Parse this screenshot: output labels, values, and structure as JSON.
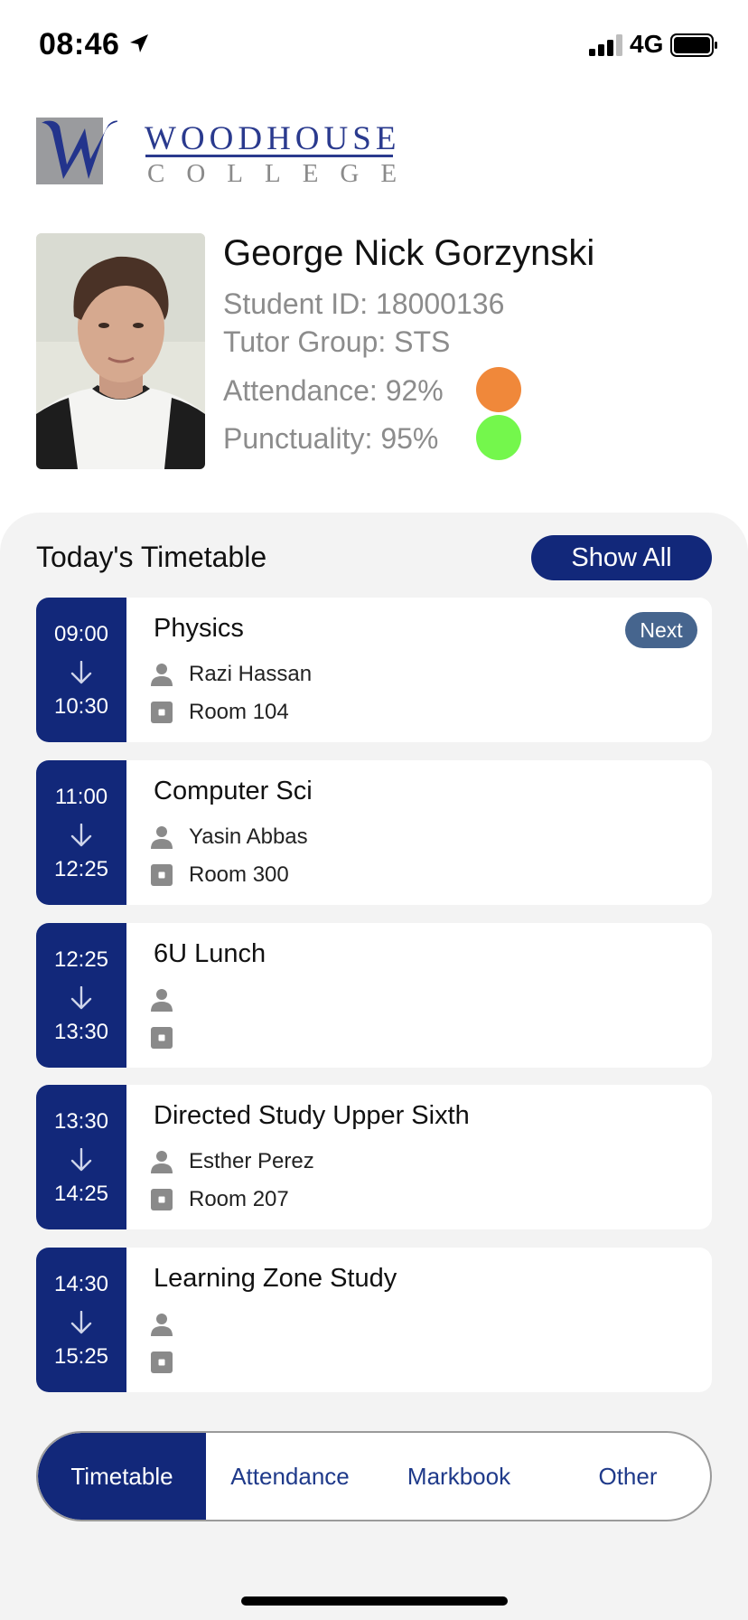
{
  "status_bar": {
    "time": "08:46",
    "network": "4G"
  },
  "logo": {
    "name": "WOODHOUSE",
    "sub": "COLLEGE"
  },
  "student": {
    "name": "George Nick Gorzynski",
    "id_text": "Student ID: 18000136",
    "tutor_text": "Tutor Group: STS",
    "attendance_text": "Attendance: 92%",
    "punctuality_text": "Punctuality: 95%",
    "attendance_pct": 92,
    "punctuality_pct": 95,
    "attendance_color": "#f0883a",
    "punctuality_color": "#74f74c"
  },
  "timetable": {
    "title": "Today's Timetable",
    "show_all_label": "Show All",
    "lessons": [
      {
        "start": "09:00",
        "end": "10:30",
        "subject": "Physics",
        "teacher": "Razi Hassan",
        "room": "Room 104",
        "badge": "Next"
      },
      {
        "start": "11:00",
        "end": "12:25",
        "subject": "Computer Sci",
        "teacher": "Yasin Abbas",
        "room": "Room 300",
        "badge": ""
      },
      {
        "start": "12:25",
        "end": "13:30",
        "subject": "6U Lunch",
        "teacher": "",
        "room": "",
        "badge": ""
      },
      {
        "start": "13:30",
        "end": "14:25",
        "subject": "Directed Study Upper Sixth",
        "teacher": "Esther Perez",
        "room": "Room 207",
        "badge": ""
      },
      {
        "start": "14:30",
        "end": "15:25",
        "subject": "Learning Zone Study",
        "teacher": "",
        "room": "",
        "badge": ""
      }
    ]
  },
  "tabs": [
    {
      "label": "Timetable",
      "active": true
    },
    {
      "label": "Attendance",
      "active": false
    },
    {
      "label": "Markbook",
      "active": false
    },
    {
      "label": "Other",
      "active": false
    }
  ],
  "colors": {
    "navy": "#12287a",
    "badge": "#46658e",
    "panel": "#f3f3f3"
  }
}
